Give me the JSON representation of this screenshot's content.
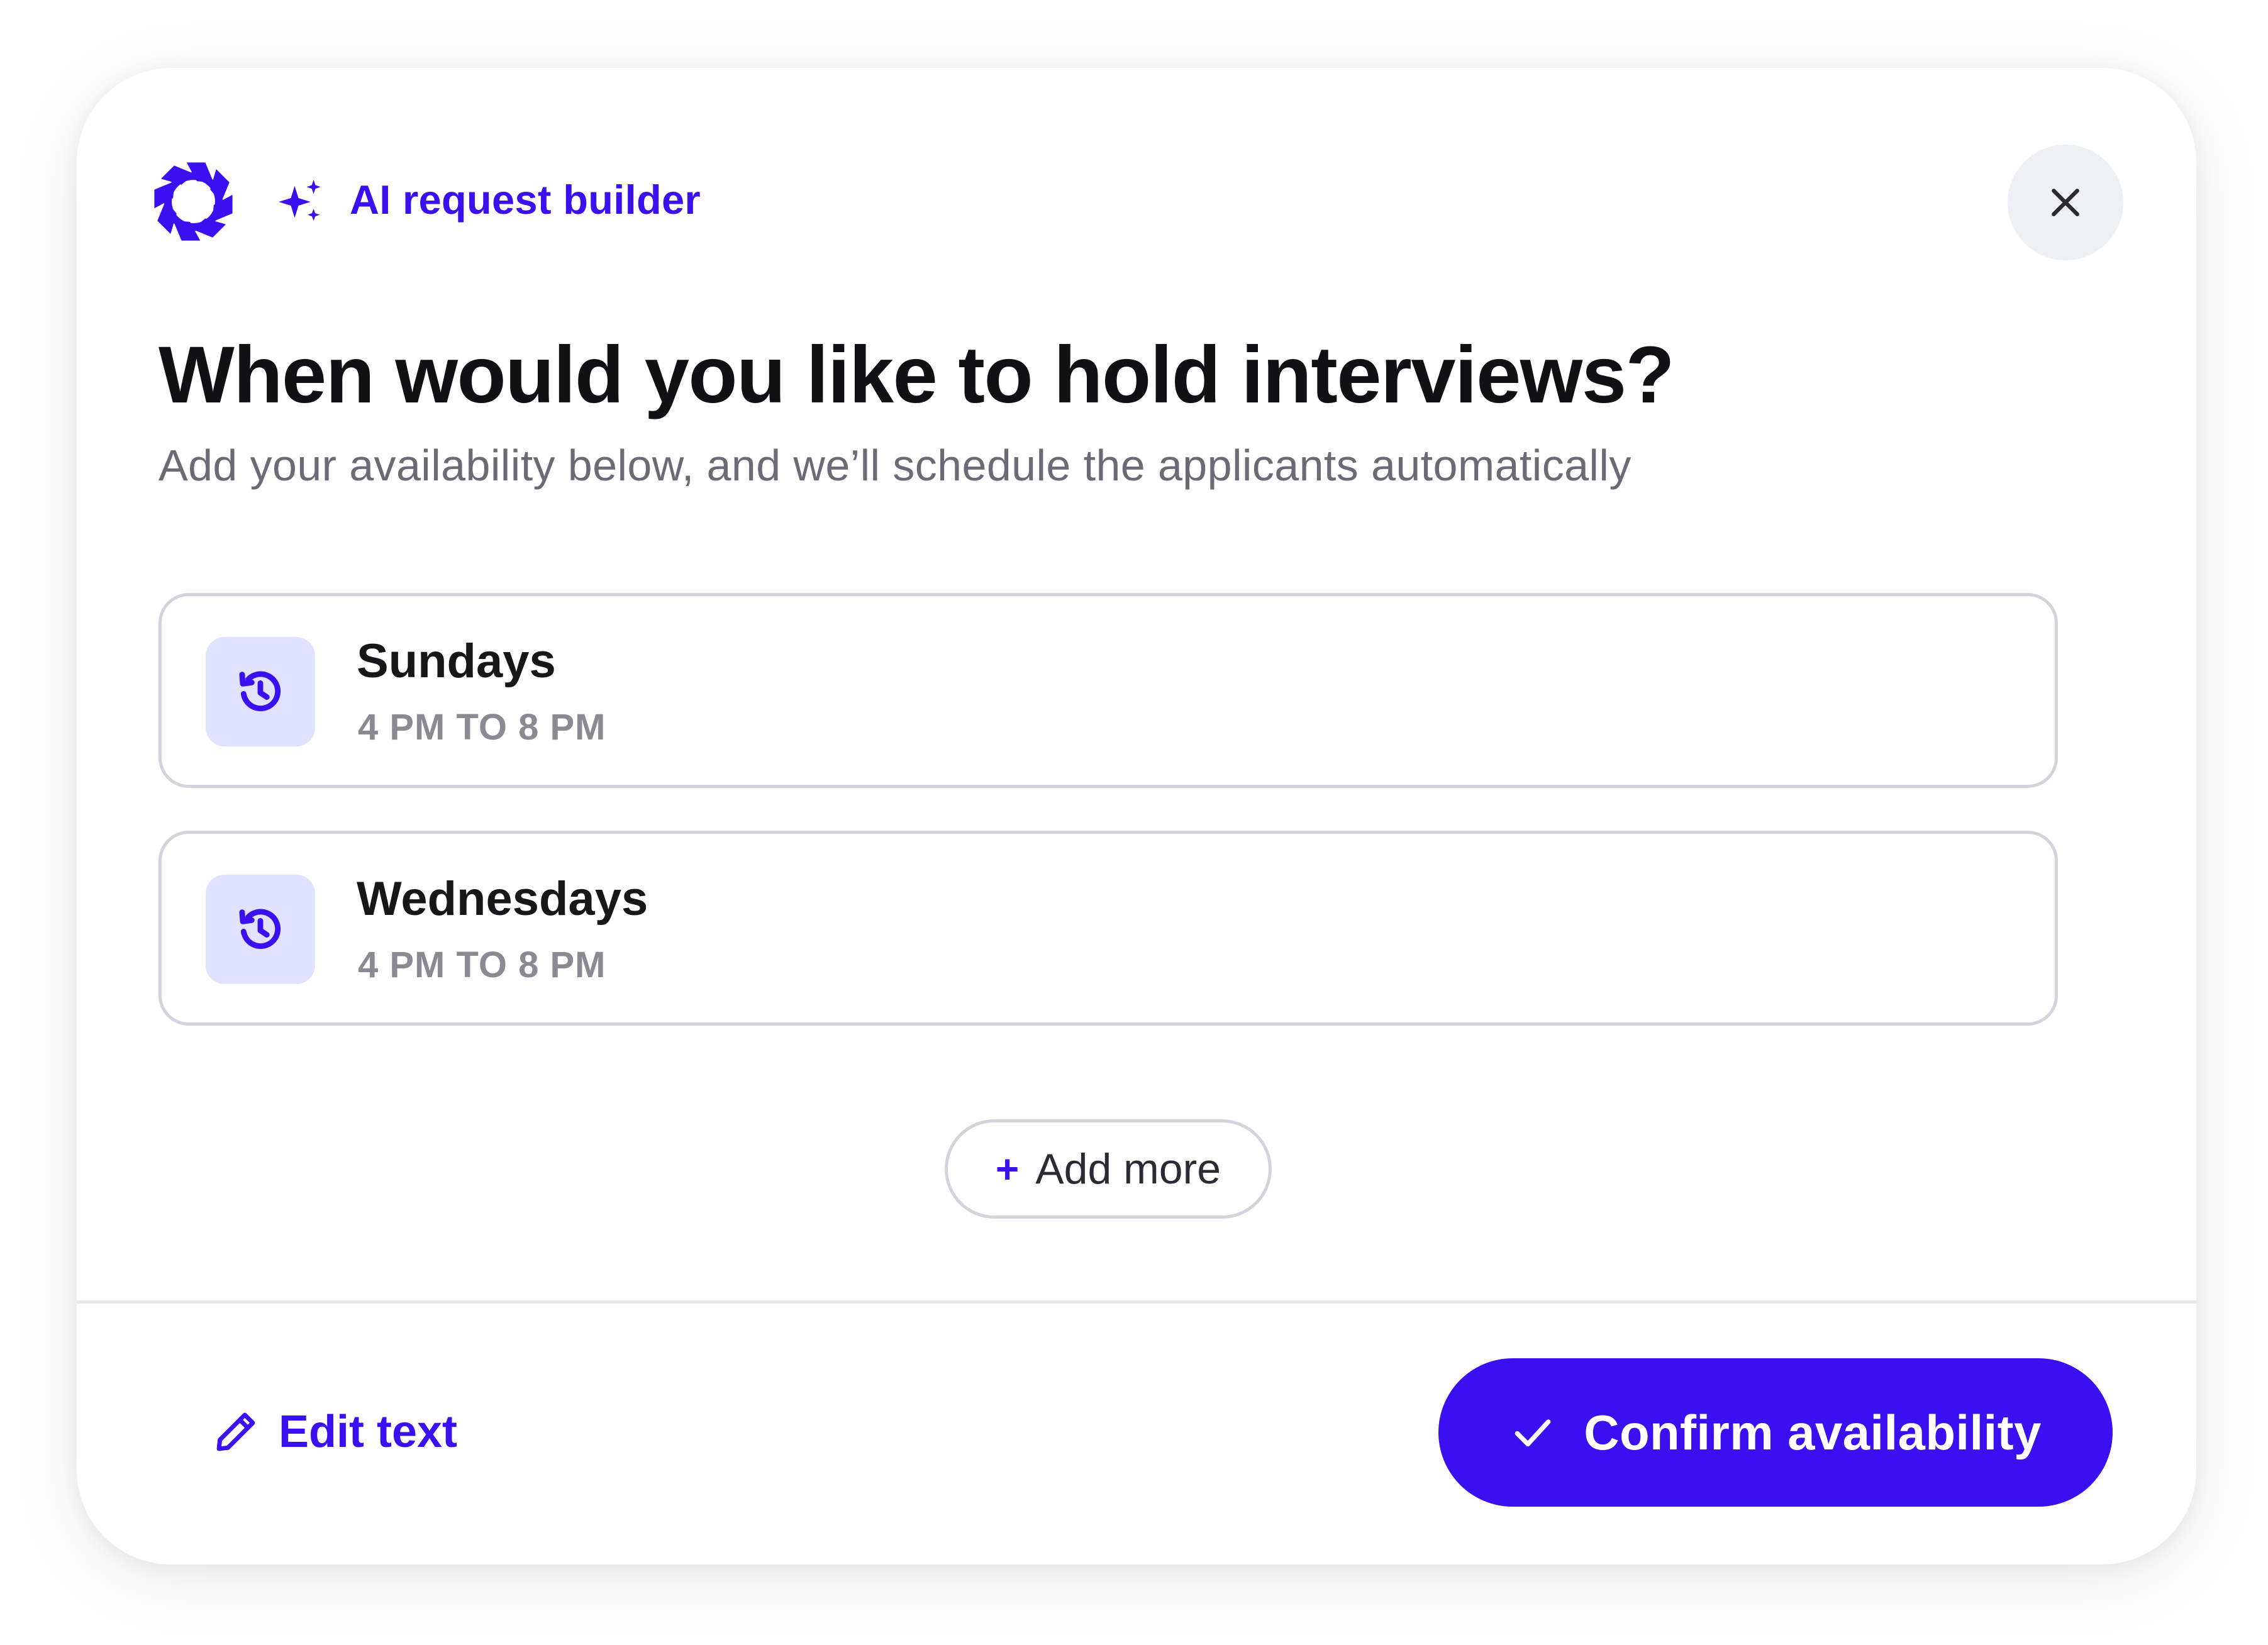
{
  "header": {
    "logo_icon": "brand-logo-icon",
    "sparkle_icon": "sparkle-icon",
    "title": "AI request builder",
    "close_icon": "close-icon"
  },
  "main": {
    "title": "When would you like to hold interviews?",
    "subtitle": "Add your availability below, and we’ll schedule the applicants automatically",
    "slots": [
      {
        "day": "Sundays",
        "time": "4 PM TO 8 PM",
        "icon": "history-clock-icon"
      },
      {
        "day": "Wednesdays",
        "time": "4 PM TO 8 PM",
        "icon": "history-clock-icon"
      }
    ],
    "add_more": {
      "plus": "+",
      "label": "Add more"
    }
  },
  "footer": {
    "edit_label": "Edit text",
    "edit_icon": "pencil-icon",
    "confirm_label": "Confirm availability",
    "confirm_icon": "check-icon"
  },
  "colors": {
    "accent": "#3b10f0",
    "icon_tile": "#e0e2fe",
    "title_text": "#111114",
    "muted_text": "#6b6b76",
    "border": "#d3d3dc",
    "close_bg": "#eff0f3"
  }
}
